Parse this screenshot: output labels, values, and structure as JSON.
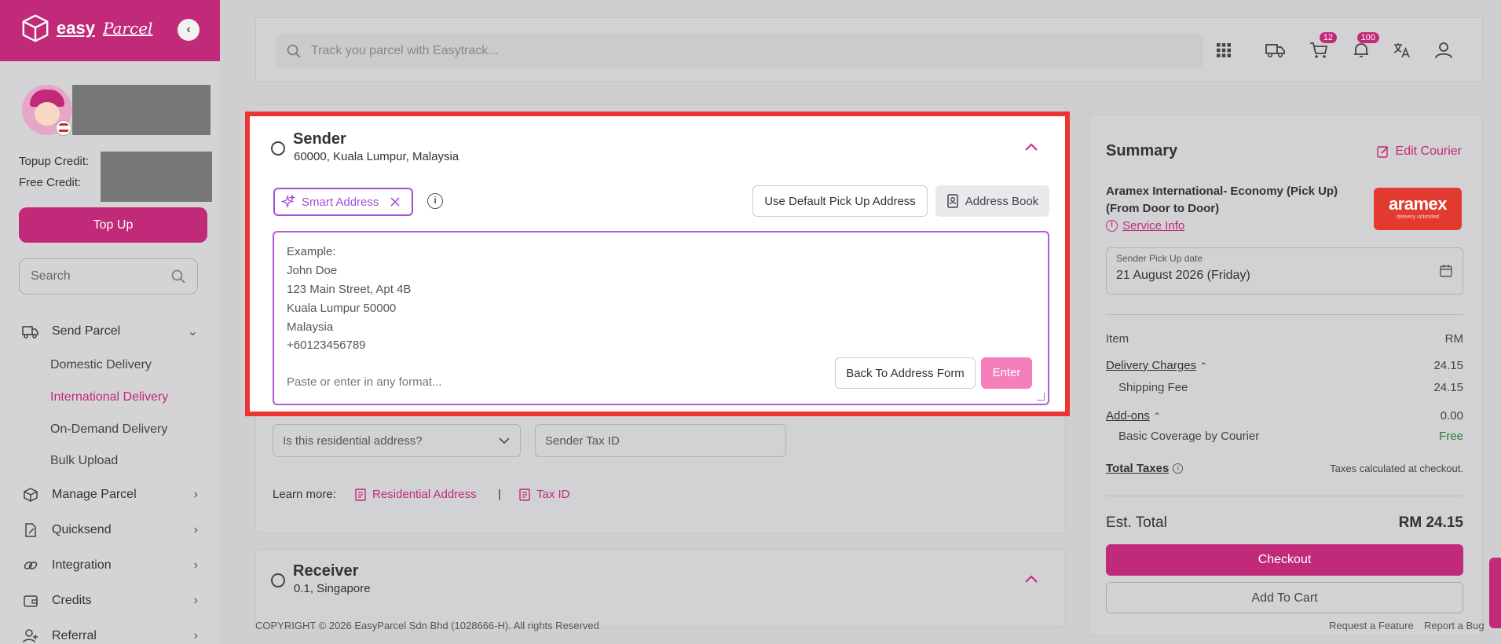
{
  "sidebar": {
    "brand_word": "easy",
    "brand_script": "Parcel",
    "topup_credit_label": "Topup Credit:",
    "free_credit_label": "Free Credit:",
    "topup_button": "Top Up",
    "search_placeholder": "Search",
    "nav": [
      {
        "label": "Send Parcel",
        "icon": "truck-icon"
      },
      {
        "label": "Manage Parcel",
        "icon": "box-icon"
      },
      {
        "label": "Quicksend",
        "icon": "edit-icon"
      },
      {
        "label": "Integration",
        "icon": "link-icon"
      },
      {
        "label": "Credits",
        "icon": "wallet-icon"
      },
      {
        "label": "Referral",
        "icon": "user-plus-icon"
      }
    ],
    "send_parcel_sub": [
      "Domestic Delivery",
      "International Delivery",
      "On-Demand Delivery",
      "Bulk Upload"
    ]
  },
  "topbar": {
    "search_placeholder": "Track you parcel with Easytrack...",
    "cart_badge": "12",
    "notif_badge": "100"
  },
  "sender": {
    "title": "Sender",
    "subtitle": "60000, Kuala Lumpur, Malaysia",
    "smart_address": "Smart Address",
    "default_pickup": "Use Default Pick Up Address",
    "address_book": "Address Book",
    "example_lines": [
      "Example:",
      "John Doe",
      "123 Main Street, Apt 4B",
      "Kuala Lumpur 50000",
      "Malaysia",
      "+60123456789"
    ],
    "placeholder": "Paste or enter in any format...",
    "back_button": "Back To Address Form",
    "enter_button": "Enter",
    "residential_select": "Is this residential address?",
    "tax_id_placeholder": "Sender Tax ID",
    "learn_more": "Learn more:",
    "link_residential": "Residential Address",
    "separator": "|",
    "link_tax": "Tax ID"
  },
  "receiver": {
    "title": "Receiver",
    "subtitle": "0.1, Singapore"
  },
  "summary": {
    "title": "Summary",
    "edit_courier": "Edit Courier",
    "courier_name": "Aramex International- Economy (Pick Up) (From Door to Door)",
    "service_info": "Service Info",
    "courier_logo": "aramex",
    "courier_logo_tag": "delivery unlimited",
    "date_label": "Sender Pick Up date",
    "date_value": "21 August 2026 (Friday)",
    "item_label": "Item",
    "currency": "RM",
    "delivery_charges": "Delivery Charges",
    "delivery_charges_value": "24.15",
    "shipping_fee": "Shipping Fee",
    "shipping_fee_value": "24.15",
    "addons": "Add-ons",
    "addons_value": "0.00",
    "basic_coverage": "Basic Coverage by Courier",
    "basic_coverage_value": "Free",
    "total_taxes": "Total Taxes",
    "taxes_note": "Taxes calculated at checkout.",
    "est_total_label": "Est. Total",
    "est_total_value": "RM 24.15",
    "checkout": "Checkout",
    "add_to_cart": "Add To Cart"
  },
  "footer": {
    "copyright": "COPYRIGHT © 2026 EasyParcel Sdn Bhd (1028666-H). All rights Reserved",
    "request_feature": "Request a Feature",
    "report_bug": "Report a Bug"
  },
  "colors": {
    "brand": "#c12a78",
    "highlight": "#ee3333",
    "smart": "#a44fd8"
  }
}
